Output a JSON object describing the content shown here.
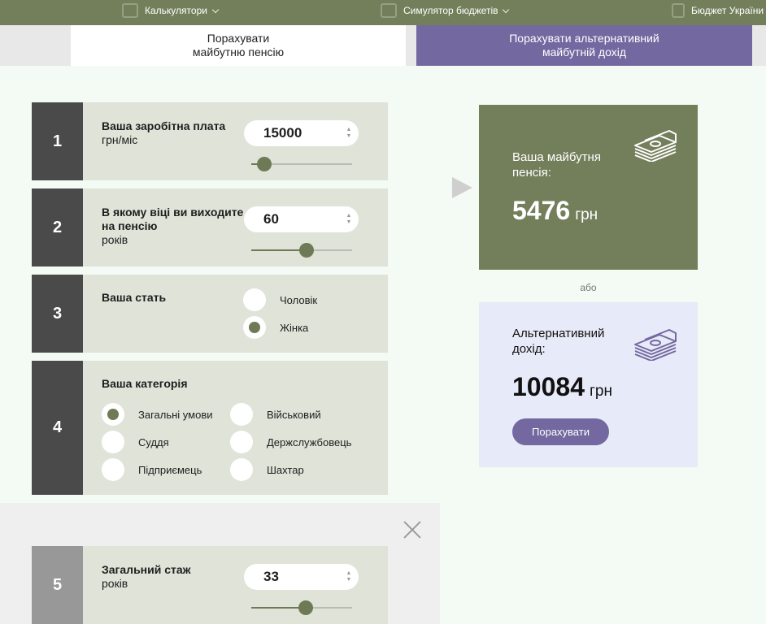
{
  "nav": {
    "calculators": "Калькулятори",
    "budget_simulator": "Симулятор бюджетів",
    "budget_ukraine": "Бюджет України"
  },
  "tabs": {
    "active_line1": "Порахувати",
    "active_line2": "майбутню пенсію",
    "alt_line1": "Порахувати альтернативний",
    "alt_line2": "майбутній дохід"
  },
  "steps": {
    "salary": {
      "num": "1",
      "title": "Ваша заробітна плата",
      "unit": "грн/міс",
      "value": "15000",
      "slider_level": 0.13
    },
    "retire_age": {
      "num": "2",
      "title_line1": "В якому віці ви виходите",
      "title_line2": "на пенсію",
      "unit": "років",
      "value": "60",
      "slider_level": 0.55
    },
    "gender": {
      "num": "3",
      "title": "Ваша стать",
      "options": [
        "Чоловік",
        "Жінка"
      ],
      "selected": "Жінка"
    },
    "category": {
      "num": "4",
      "title": "Ваша категорія",
      "options": [
        "Загальні умови",
        "Військовий",
        "Суддя",
        "Держслужбовець",
        "Підприємець",
        "Шахтар"
      ],
      "selected": "Загальні умови"
    },
    "experience": {
      "num": "5",
      "title": "Загальний стаж",
      "unit": "років",
      "value": "33",
      "slider_level": 0.54
    }
  },
  "results": {
    "pension_caption_line1": "Ваша майбутня",
    "pension_caption_line2": "пенсія:",
    "pension_amount": "5476",
    "currency": "грн",
    "or_text": "або",
    "alt_caption_line1": "Альтернативний",
    "alt_caption_line2": "дохід:",
    "alt_amount": "10084",
    "calc_button": "Порахувати"
  },
  "colors": {
    "olive": "#737f5b",
    "purple": "#7368a0",
    "card_bg": "#dfe3d8",
    "number_block": "#4a4a4a",
    "alt_panel": "#e7eaf8"
  },
  "icons": [
    "money-stack-icon",
    "close-icon",
    "chevron-down-icon",
    "play-arrow-icon"
  ]
}
